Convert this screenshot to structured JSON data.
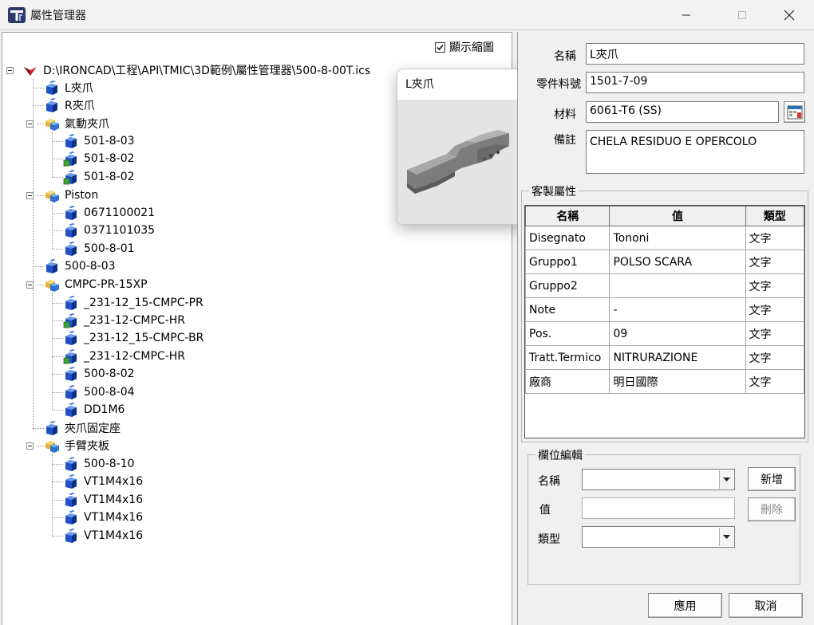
{
  "window": {
    "title": "屬性管理器"
  },
  "tree": {
    "show_thumbnail_label": "顯示縮圖",
    "show_thumbnail_checked": true,
    "root": "D:\\IRONCAD\\工程\\API\\TMIC\\3D範例\\屬性管理器\\500-8-00T.ics",
    "nodes": [
      {
        "label": "L夾爪",
        "type": "part"
      },
      {
        "label": "R夾爪",
        "type": "part"
      },
      {
        "label": "氣動夾爪",
        "type": "assembly"
      },
      {
        "label": "501-8-03",
        "type": "part"
      },
      {
        "label": "501-8-02",
        "type": "part-linked"
      },
      {
        "label": "501-8-02",
        "type": "part-linked"
      },
      {
        "label": "Piston",
        "type": "assembly"
      },
      {
        "label": "0671100021",
        "type": "part"
      },
      {
        "label": "0371101035",
        "type": "part"
      },
      {
        "label": "500-8-01",
        "type": "part"
      },
      {
        "label": "500-8-03",
        "type": "part"
      },
      {
        "label": "CMPC-PR-15XP",
        "type": "assembly"
      },
      {
        "label": "_231-12_15-CMPC-PR",
        "type": "part"
      },
      {
        "label": "_231-12-CMPC-HR",
        "type": "part-linked"
      },
      {
        "label": "_231-12_15-CMPC-BR",
        "type": "part"
      },
      {
        "label": "_231-12-CMPC-HR",
        "type": "part-linked"
      },
      {
        "label": "500-8-02",
        "type": "part"
      },
      {
        "label": "500-8-04",
        "type": "part"
      },
      {
        "label": "DD1M6",
        "type": "part"
      },
      {
        "label": "夾爪固定座",
        "type": "part"
      },
      {
        "label": "手臂夾板",
        "type": "assembly"
      },
      {
        "label": "500-8-10",
        "type": "part"
      },
      {
        "label": "VT1M4x16",
        "type": "part"
      },
      {
        "label": "VT1M4x16",
        "type": "part"
      },
      {
        "label": "VT1M4x16",
        "type": "part"
      },
      {
        "label": "VT1M4x16",
        "type": "part"
      }
    ]
  },
  "preview": {
    "title": "L夾爪"
  },
  "form": {
    "name_label": "名稱",
    "name_value": "L夾爪",
    "partno_label": "零件料號",
    "partno_value": "1501-7-09",
    "material_label": "材料",
    "material_value": "6061-T6 (SS)",
    "remark_label": "備註",
    "remark_value": "CHELA RESIDUO E OPERCOLO"
  },
  "custom": {
    "group_title": "客製屬性",
    "headers": [
      "名稱",
      "值",
      "類型"
    ],
    "rows": [
      [
        "Disegnato",
        "Tononi",
        "文字"
      ],
      [
        "Gruppo1",
        "POLSO SCARA",
        "文字"
      ],
      [
        "Gruppo2",
        "",
        "文字"
      ],
      [
        "Note",
        "-",
        "文字"
      ],
      [
        "Pos.",
        "09",
        "文字"
      ],
      [
        "Tratt.Termico",
        "NITRURAZIONE",
        "文字"
      ],
      [
        "廠商",
        "明日國際",
        "文字"
      ]
    ]
  },
  "edit": {
    "group_title": "欄位編輯",
    "name_label": "名稱",
    "value_label": "值",
    "type_label": "類型",
    "add_button": "新增",
    "delete_button": "刪除"
  },
  "buttons": {
    "apply": "應用",
    "cancel": "取消"
  }
}
